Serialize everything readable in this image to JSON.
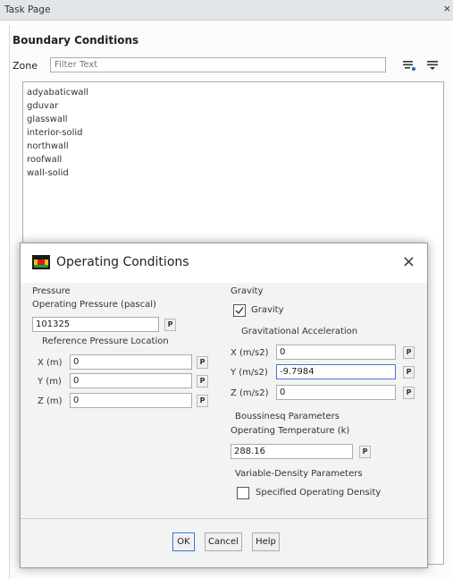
{
  "task_page": {
    "title": "Task Page",
    "close_glyph": "×"
  },
  "boundary_conditions": {
    "title": "Boundary Conditions",
    "zone_label": "Zone",
    "filter_placeholder": "Filter Text",
    "zones": [
      "adyabaticwall",
      "gduvar",
      "glasswall",
      "interior-solid",
      "northwall",
      "roofwall",
      "wall-solid"
    ]
  },
  "dialog": {
    "title": "Operating Conditions",
    "close_glyph": "×",
    "pressure": {
      "group_label": "Pressure",
      "operating_pressure_label": "Operating Pressure (pascal)",
      "operating_pressure_value": "101325",
      "ref_location_label": "Reference Pressure Location",
      "x_label": "X (m)",
      "x_value": "0",
      "y_label": "Y (m)",
      "y_value": "0",
      "z_label": "Z (m)",
      "z_value": "0"
    },
    "gravity": {
      "group_label": "Gravity",
      "checkbox_label": "Gravity",
      "checked": true,
      "accel_label": "Gravitational Acceleration",
      "x_label": "X (m/s2)",
      "x_value": "0",
      "y_label": "Y (m/s2)",
      "y_value": "-9.7984",
      "z_label": "Z (m/s2)",
      "z_value": "0"
    },
    "boussinesq": {
      "group_label": "Boussinesq Parameters",
      "temp_label": "Operating Temperature (k)",
      "temp_value": "288.16"
    },
    "variable_density": {
      "group_label": "Variable-Density Parameters",
      "checkbox_label": "Specified Operating Density",
      "checked": false
    },
    "p_label": "P",
    "buttons": {
      "ok": "OK",
      "cancel": "Cancel",
      "help": "Help"
    }
  },
  "colors": {
    "accent": "#2a6fd6",
    "dialog_bg": "#f3f3f3"
  }
}
